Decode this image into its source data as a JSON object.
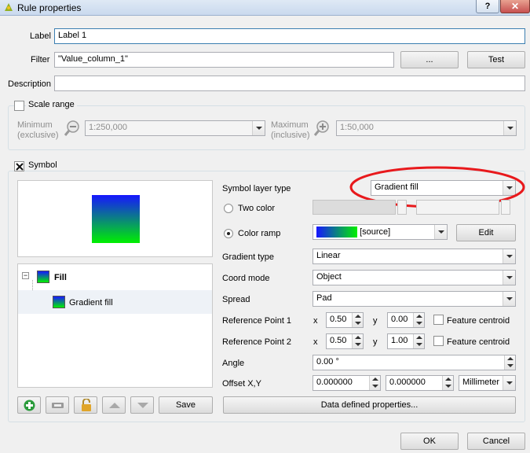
{
  "window": {
    "title": "Rule properties",
    "help_label": "?",
    "close_label": "✕"
  },
  "form": {
    "label_label": "Label",
    "label_value": "Label 1",
    "filter_label": "Filter",
    "filter_value": "\"Value_column_1\"",
    "filter_more_button": "...",
    "test_button": "Test",
    "description_label": "Description",
    "description_value": ""
  },
  "scale_range": {
    "title": "Scale range",
    "checked": false,
    "minimum_label": "Minimum",
    "minimum_sub": "(exclusive)",
    "minimum_value": "1:250,000",
    "maximum_label": "Maximum",
    "maximum_sub": "(inclusive)",
    "maximum_value": "1:50,000"
  },
  "symbol": {
    "title": "Symbol",
    "checked": true,
    "tree": {
      "root": "Fill",
      "child": "Gradient fill"
    },
    "save_button": "Save",
    "layer_type_label": "Symbol layer type",
    "layer_type_value": "Gradient fill",
    "two_color_label": "Two color",
    "color_ramp_label": "Color ramp",
    "color_ramp_value": "[source]",
    "edit_button": "Edit",
    "gradient_type_label": "Gradient type",
    "gradient_type_value": "Linear",
    "coord_mode_label": "Coord mode",
    "coord_mode_value": "Object",
    "spread_label": "Spread",
    "spread_value": "Pad",
    "ref1_label": "Reference Point 1",
    "ref2_label": "Reference Point 2",
    "x_label": "x",
    "y_label": "y",
    "ref1_x": "0.50",
    "ref1_y": "0.00",
    "ref2_x": "0.50",
    "ref2_y": "1.00",
    "feature_centroid_label": "Feature centroid",
    "angle_label": "Angle",
    "angle_value": "0.00 °",
    "offset_label": "Offset X,Y",
    "offset_x": "0.000000",
    "offset_y": "0.000000",
    "offset_unit": "Millimeter",
    "data_defined_button": "Data defined properties..."
  },
  "footer": {
    "ok_button": "OK",
    "cancel_button": "Cancel"
  },
  "colors": {
    "gradient_top": "#1616ff",
    "gradient_bottom": "#00f000",
    "highlight_ellipse": "#e8191c"
  }
}
